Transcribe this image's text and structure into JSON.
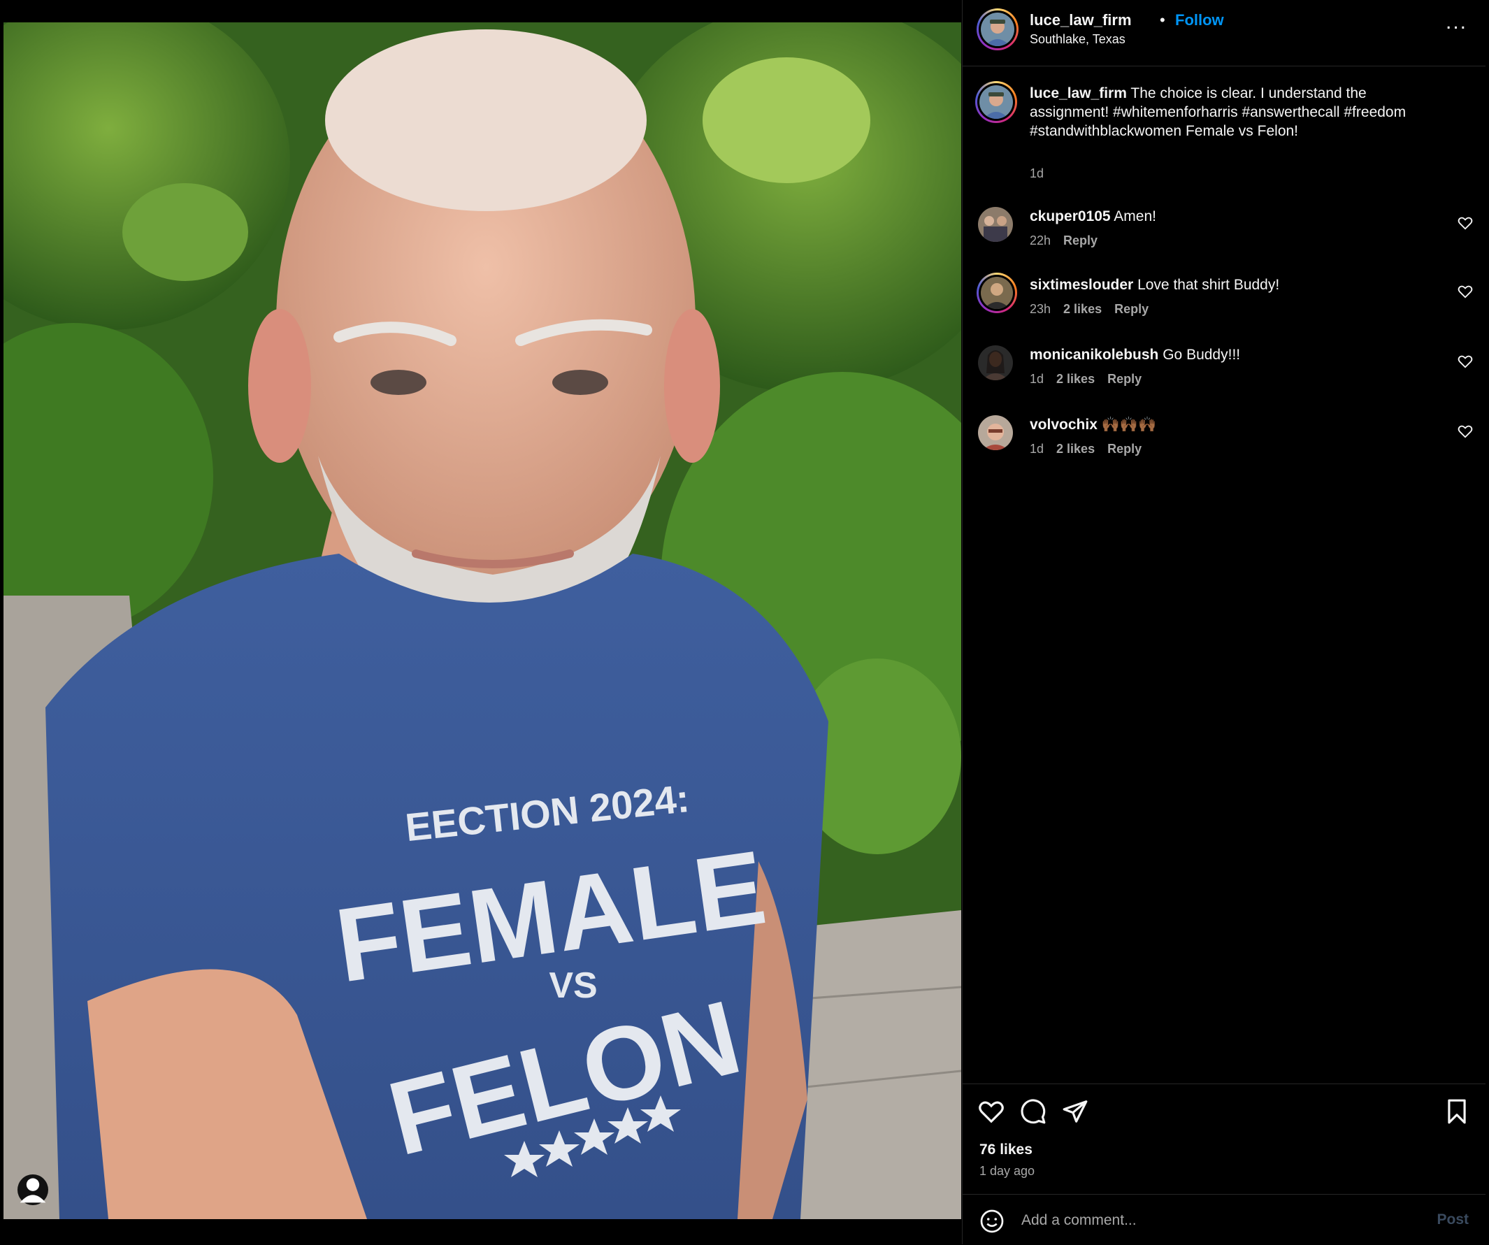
{
  "post": {
    "shirt": {
      "line1": "EECTION 2024:",
      "line2": "FEMALE",
      "line3": "VS",
      "line4": "FELON"
    }
  },
  "header": {
    "username": "luce_law_firm",
    "separator": "•",
    "follow_label": "Follow",
    "location": "Southlake, Texas",
    "more_label": "..."
  },
  "caption": {
    "username": "luce_law_firm",
    "text": "The choice is clear. I understand the assignment! #whitemenforharris #answerthecall #freedom #standwithblackwomen Female vs Felon!",
    "time": "1d"
  },
  "comments": [
    {
      "username": "ckuper0105",
      "text": "Amen!",
      "time": "22h",
      "likes": "",
      "reply": "Reply"
    },
    {
      "username": "sixtimeslouder",
      "text": "Love that shirt Buddy!",
      "time": "23h",
      "likes": "2 likes",
      "reply": "Reply"
    },
    {
      "username": "monicanikolebush",
      "text": "Go Buddy!!!",
      "time": "1d",
      "likes": "2 likes",
      "reply": "Reply"
    },
    {
      "username": "volvochix",
      "text": "🙌🏾🙌🏾🙌🏾",
      "time": "1d",
      "likes": "2 likes",
      "reply": "Reply"
    }
  ],
  "footer": {
    "likes": "76 likes",
    "time_ago": "1 day ago",
    "comment_placeholder": "Add a comment...",
    "post_label": "Post"
  },
  "icons": [
    "heart-icon",
    "comment-icon",
    "share-icon",
    "bookmark-icon",
    "emoji-icon",
    "user-tag-icon",
    "more-icon"
  ],
  "colors": {
    "accent": "#0095f6",
    "background": "#000000",
    "muted": "#a8a8a8",
    "shirt": "#3a5896"
  }
}
